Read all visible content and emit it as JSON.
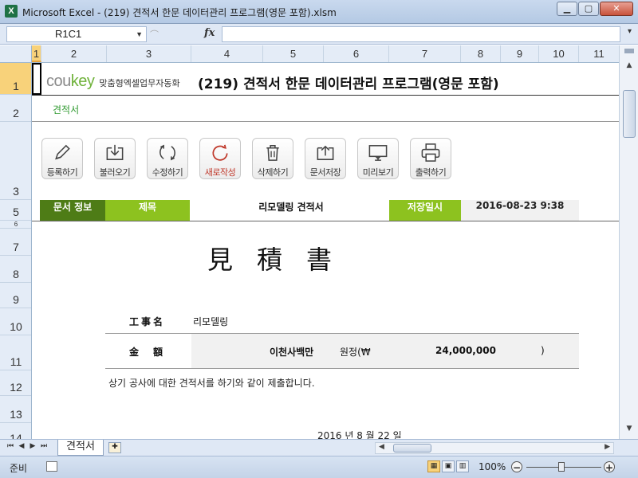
{
  "window": {
    "title": "Microsoft Excel - (219) 견적서 한문 데이터관리 프로그램(영문 포함).xlsm",
    "app_icon": "X",
    "buttons": [
      "minimize",
      "maximize",
      "close"
    ]
  },
  "formula_bar": {
    "name_box": "R1C1",
    "fx_label": "fx",
    "formula": ""
  },
  "columns": [
    "1",
    "2",
    "3",
    "4",
    "5",
    "6",
    "7",
    "8",
    "9",
    "10",
    "11"
  ],
  "rows": [
    "1",
    "2",
    "3",
    "5",
    "6",
    "7",
    "8",
    "9",
    "10",
    "11",
    "12",
    "13",
    "14"
  ],
  "sheet": {
    "brand": {
      "logo_a": "cou",
      "logo_b": "key",
      "tagline": "맞춤형엑셀업무자동화"
    },
    "doc_title": "(219) 견적서 한문 데이터관리 프로그램(영문 포함)",
    "sub_title": "견적서",
    "toolbar": [
      {
        "label": "등록하기",
        "icon": "pencil-icon"
      },
      {
        "label": "불러오기",
        "icon": "download-icon"
      },
      {
        "label": "수정하기",
        "icon": "refresh-icon"
      },
      {
        "label": "새로작성",
        "icon": "new-icon"
      },
      {
        "label": "삭제하기",
        "icon": "trash-icon"
      },
      {
        "label": "문서저장",
        "icon": "upload-icon"
      },
      {
        "label": "미리보기",
        "icon": "monitor-icon"
      },
      {
        "label": "출력하기",
        "icon": "printer-icon"
      }
    ],
    "info": {
      "doc_info_label": "문서 정보",
      "subject_label": "제목",
      "subject_value": "리모델링 견적서",
      "saved_label": "저장일시",
      "saved_value": "2016-08-23 9:38"
    },
    "heading_kanji": "見積書",
    "estimate": {
      "work_label": "工事名",
      "work_value": "리모델링",
      "amount_label": "金額",
      "amount_korean": "이천사백만",
      "won_text": "원정(₩",
      "amount_number": "24,000,000",
      "close_paren": ")"
    },
    "notice": "상기 공사에 대한 견적서를 하기와 같이 제출합니다.",
    "date_line": "2016 년 8 월 22 일"
  },
  "tabs": {
    "active": "견적서"
  },
  "status": {
    "ready": "준비",
    "zoom": "100%"
  },
  "colors": {
    "dark_green": "#4e7c16",
    "light_green": "#8dc21f",
    "accent_text_green": "#2f9a2f",
    "selection": "#f8d27a"
  }
}
